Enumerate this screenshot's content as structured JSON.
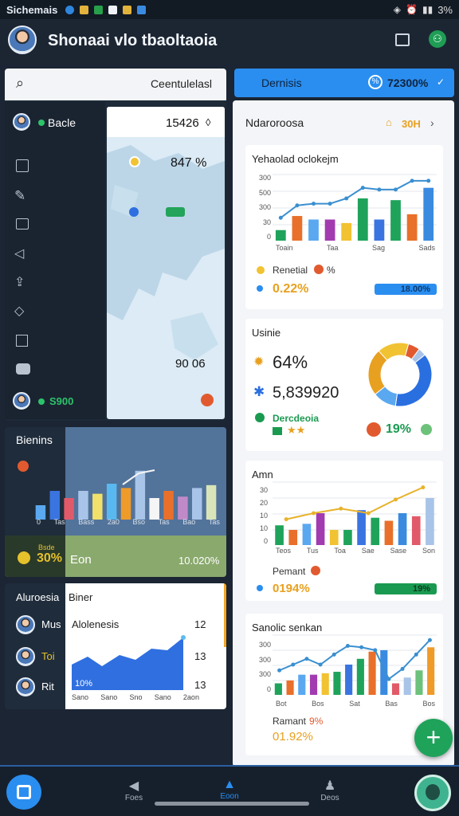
{
  "status_bar": {
    "left": "Sichemais",
    "right": "3%"
  },
  "header": {
    "title": "Shonaai vlo tbaoltaoia"
  },
  "search": {
    "label": "Ceentulelasl"
  },
  "sidebar": {
    "profile_name": "Bacle",
    "footer_value": "S900"
  },
  "map_card": {
    "top_value": "15426",
    "mid_value": "847 %",
    "bottom_value": "90 06"
  },
  "business": {
    "title": "Bienins",
    "axis": [
      "0",
      "Tas",
      "Bass",
      "2a0",
      "Bso",
      "Tas",
      "Bao",
      "Tas"
    ],
    "footer_small": "Bsde",
    "footer_value": "30%",
    "footer_label": "Eon",
    "footer_right": "10.020%",
    "chart_data": {
      "type": "bar",
      "values": [
        1,
        2,
        1.5,
        2,
        1.8,
        2.5,
        2.2,
        3.4,
        1.5,
        2,
        1.6,
        2.2,
        2.4
      ]
    }
  },
  "alert": {
    "title": "Aluroesia",
    "sub_title": "Biner",
    "rows": [
      {
        "name": "Mus"
      },
      {
        "name": "Toi"
      },
      {
        "name": "Rit"
      }
    ],
    "chart_title": "Alolenesis",
    "right_values": [
      "12",
      "13",
      "13"
    ],
    "inner_value": "10%",
    "axis": [
      "Sano",
      "Sano",
      "Sno",
      "Sano",
      "2aon"
    ]
  },
  "tabbar": {
    "left_label": "Dernisis",
    "right_label": "72300%"
  },
  "summary": {
    "title": "Ndaroroosa",
    "right": "30H"
  },
  "card1": {
    "title": "Yehaolad oclokejm",
    "ylabels": [
      "300",
      "500",
      "300",
      "30",
      "0"
    ],
    "xlabels": [
      "Toain",
      "Taa",
      "Sag",
      "Sads"
    ],
    "legend": "Renetial",
    "legend_pct": "%",
    "value": "0.22%",
    "pill": "18.00%",
    "chart_data": {
      "type": "bar",
      "values": [
        0.6,
        1.4,
        1.2,
        1.2,
        1.0,
        2.4,
        1.2,
        2.3,
        1.5,
        3.0
      ],
      "line": [
        1.3,
        2.0,
        2.1,
        2.1,
        2.4,
        3.0,
        2.9,
        2.9,
        3.4,
        3.4
      ]
    }
  },
  "card2": {
    "title": "Usinie",
    "stat1": "64%",
    "stat2": "5,839920",
    "label3": "Dercdeoia",
    "ring_pct": "19%",
    "chart_data": {
      "type": "pie",
      "values": [
        38,
        12,
        24,
        16,
        6,
        4
      ]
    }
  },
  "card3": {
    "title": "Amn",
    "ylabels": [
      "30",
      "20",
      "10",
      "10",
      "0"
    ],
    "xlabels": [
      "Teos",
      "Tus",
      "Toa",
      "Sae",
      "Sase",
      "Son"
    ],
    "legend": "Pemant",
    "value": "0194%",
    "pill": "19%",
    "chart_data": {
      "type": "bar",
      "values": [
        1.3,
        1.0,
        1.4,
        2.1,
        1.0,
        1.0,
        2.3,
        1.8,
        1.6,
        2.1,
        1.9,
        3.1
      ],
      "line": [
        1.7,
        2.1,
        2.4,
        2.1,
        3.0,
        3.8
      ]
    }
  },
  "card4": {
    "title": "Sanolic senkan",
    "ylabels": [
      "300",
      "300",
      "300",
      "0"
    ],
    "xlabels": [
      "Bot",
      "Bos",
      "Sat",
      "Bas",
      "Bos"
    ],
    "legend": "Ramant",
    "legend_pct": "9%",
    "value": "01.92%",
    "chart_data": {
      "type": "bar",
      "values": [
        0.8,
        1.0,
        1.4,
        1.4,
        1.5,
        1.6,
        2.1,
        2.5,
        3.0,
        3.1,
        0.8,
        1.2,
        1.7,
        3.3
      ],
      "line": [
        1.7,
        2.1,
        2.5,
        2.1,
        2.8,
        3.4,
        3.3,
        3.1,
        1.1,
        1.8,
        2.8,
        3.8
      ]
    }
  },
  "bottom_nav": {
    "items": [
      "Foes",
      "Eoon",
      "Deos"
    ]
  }
}
